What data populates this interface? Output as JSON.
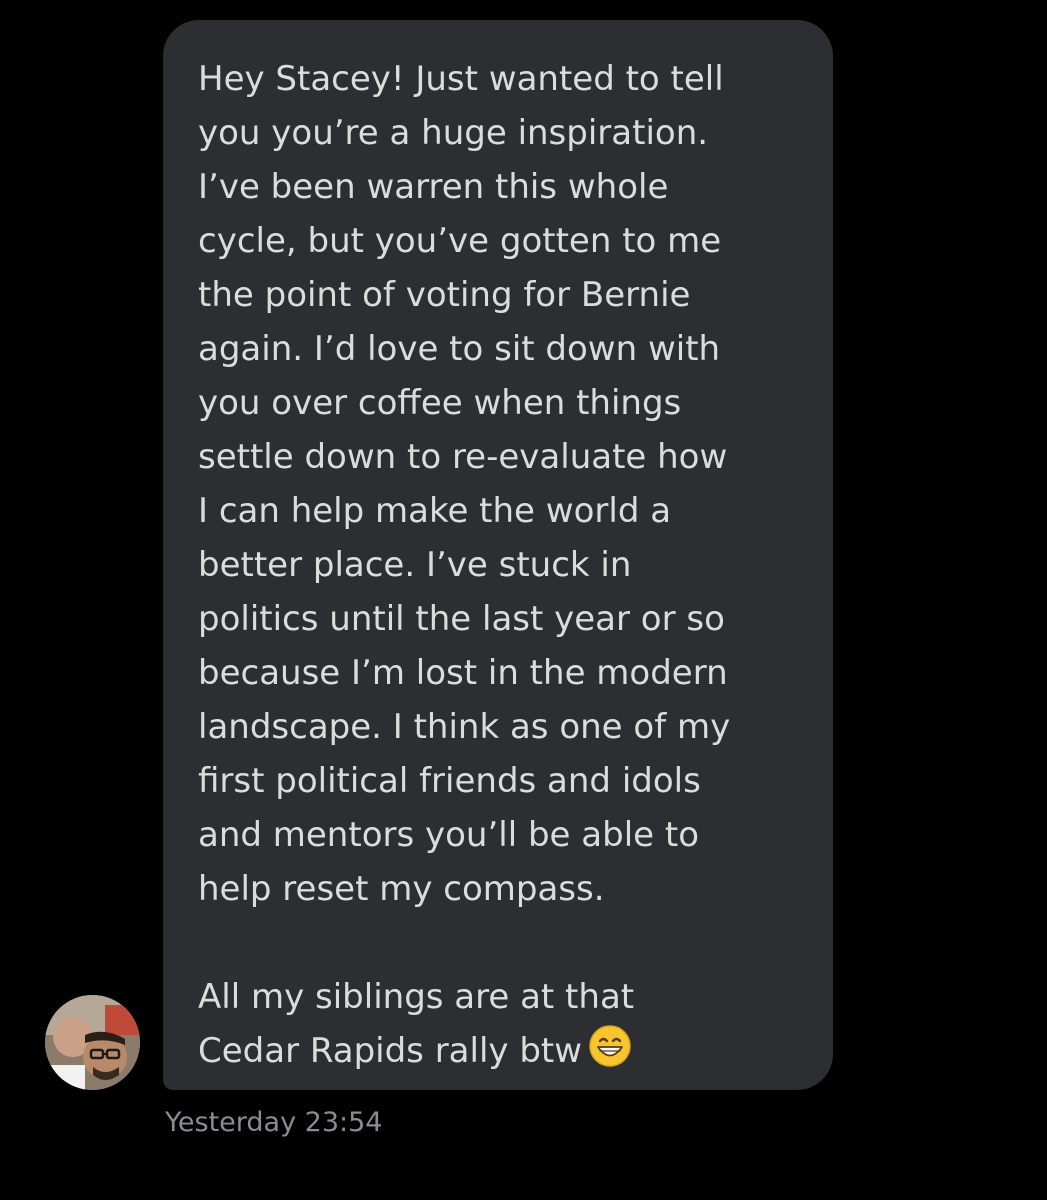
{
  "message": {
    "lines": [
      "Hey Stacey! Just wanted to tell",
      "you you’re a huge inspiration.",
      "I’ve been warren this whole",
      "cycle, but you’ve gotten to me",
      "the point of voting for Bernie",
      "again. I’d love to sit down with",
      "you over coffee when things",
      "settle down to re-evaluate how",
      "I can help make the world a",
      "better place. I’ve stuck in",
      "politics until the last year or so",
      "because I’m lost in the modern",
      "landscape. I think as one of my",
      "first political friends and idols",
      "and mentors you’ll be able to",
      "help reset my compass.",
      "",
      "All my siblings are at that",
      "Cedar Rapids rally btw"
    ],
    "emoji": "grinning-face-with-smiling-eyes-icon",
    "bubble_color": "#2c2e31",
    "text_color": "#dcdcdc"
  },
  "sender": {
    "avatar": "avatar-photo"
  },
  "timestamp": "Yesterday 23:54",
  "background_color": "#000000"
}
